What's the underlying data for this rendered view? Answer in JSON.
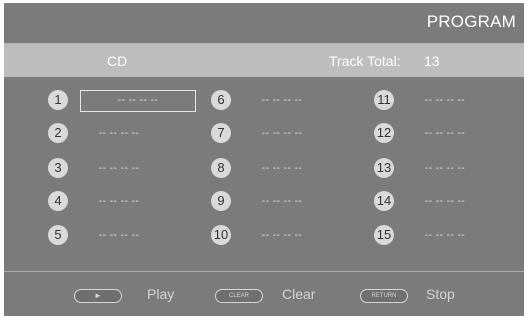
{
  "title": "PROGRAM",
  "header": {
    "source": "CD",
    "track_total_label": "Track Total:",
    "track_total_value": "13"
  },
  "slots": [
    {
      "number": "1",
      "value": "-- -- -- --",
      "selected": true
    },
    {
      "number": "2",
      "value": "-- -- -- --"
    },
    {
      "number": "3",
      "value": "-- -- -- --"
    },
    {
      "number": "4",
      "value": "-- -- -- --"
    },
    {
      "number": "5",
      "value": "-- -- -- --"
    },
    {
      "number": "6",
      "value": "-- -- -- --"
    },
    {
      "number": "7",
      "value": "-- -- -- --"
    },
    {
      "number": "8",
      "value": "-- -- -- --"
    },
    {
      "number": "9",
      "value": "-- -- -- --"
    },
    {
      "number": "10",
      "value": "-- -- -- --"
    },
    {
      "number": "11",
      "value": "-- -- -- --"
    },
    {
      "number": "12",
      "value": "-- -- -- --"
    },
    {
      "number": "13",
      "value": "-- -- -- --"
    },
    {
      "number": "14",
      "value": "-- -- -- --"
    },
    {
      "number": "15",
      "value": "-- -- -- --"
    }
  ],
  "footer": {
    "play": {
      "key_glyph": "►",
      "label": "Play",
      "icon": "play-icon"
    },
    "clear": {
      "key_text": "CLEAR",
      "label": "Clear"
    },
    "stop": {
      "key_text": "RETURN",
      "label": "Stop"
    }
  }
}
